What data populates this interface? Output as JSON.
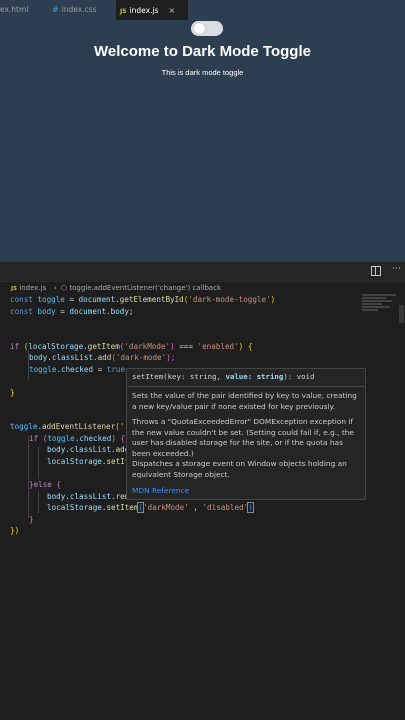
{
  "preview": {
    "title": "Welcome to Dark Mode Toggle",
    "subtitle": "This is dark mode toggle"
  },
  "tabs": [
    {
      "label": "ex.html"
    },
    {
      "label": "index.css"
    },
    {
      "label": "index.js",
      "close": "×"
    }
  ],
  "breadcrumb": {
    "file": "index.js",
    "separator": "›",
    "symbol": "toggle.addEventListener('change') callback"
  },
  "code": {
    "l1a": "const",
    "l1b": "toggle",
    "l1c": " = ",
    "l1d": "document",
    "l1e": ".",
    "l1f": "getElementById",
    "l1g": "(",
    "l1h": "'dark-mode-toggle'",
    "l1i": ")",
    "l2a": "const",
    "l2b": "body",
    "l2c": " = ",
    "l2d": "document",
    "l2e": ".",
    "l2f": "body",
    "l2g": ";",
    "l3a": "if",
    "l3b": " (",
    "l3c": "localStorage",
    "l3d": ".",
    "l3e": "getItem",
    "l3f": "(",
    "l3g": "'darkMode'",
    "l3h": ")",
    "l3i": " === ",
    "l3j": "'enabled'",
    "l3k": ")",
    "l3l": " {",
    "l4a": "body",
    "l4b": ".",
    "l4c": "classList",
    "l4d": ".",
    "l4e": "add",
    "l4f": "(",
    "l4g": "'dark-mode'",
    "l4h": ");",
    "l5a": "toggle",
    "l5b": ".",
    "l5c": "checked",
    "l5d": " = ",
    "l5e": "true",
    "l6a": "}",
    "l7a": "toggle",
    "l7b": ".",
    "l7c": "addEventListener",
    "l7d": "('",
    "l8a": "if",
    "l8b": " (",
    "l8c": "toggle",
    "l8d": ".",
    "l8e": "checked",
    "l8f": ")",
    "l8g": " {",
    "l9a": "body",
    "l9b": ".",
    "l9c": "classList",
    "l9d": ".",
    "l9e": "add",
    "l10a": "localStorage",
    "l10b": ".",
    "l10c": "setIt",
    "l11a": "}",
    "l11b": "else",
    "l11c": " {",
    "l12a": "body",
    "l12b": ".",
    "l12c": "classList",
    "l12d": ".",
    "l12e": "rem",
    "l13a": "localStorage",
    "l13b": ".",
    "l13c": "setItem",
    "l13d": "(",
    "l13e": "'darkMode'",
    "l13f": " , ",
    "l13g": "'disabled'",
    "l13h": ")",
    "l14a": "}",
    "l15a": "})"
  },
  "hover": {
    "signature_pre": "setItem(key: string, ",
    "signature_param": "value: string",
    "signature_post": "): void",
    "p1": "Sets the value of the pair identified by key to value, creating a new key/value pair if none existed for key previously.",
    "p2": "Throws a \"QuotaExceededError\" DOMException exception if the new value couldn't be set. (Setting could fail if, e.g., the user has disabled storage for the site, or if the quota has been exceeded.)",
    "p3": "Dispatches a storage event on Window objects holding an equivalent Storage object.",
    "link": "MDN Reference"
  }
}
